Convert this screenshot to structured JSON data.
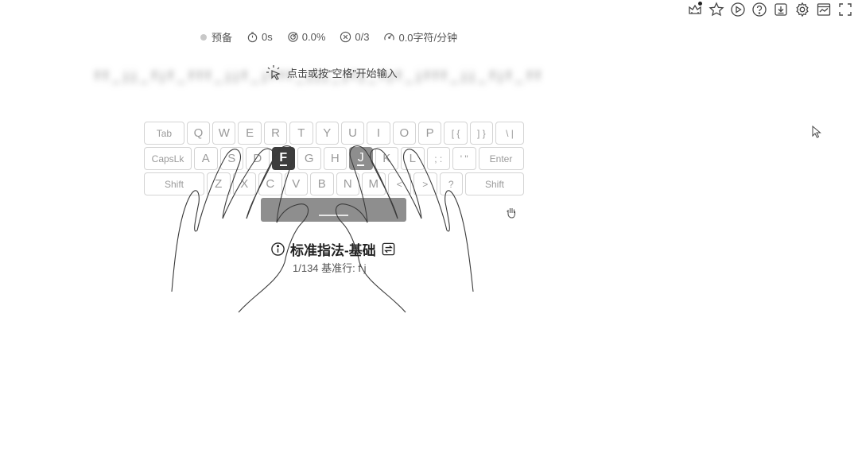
{
  "toolbar": {
    "items": [
      "crown-icon",
      "star-icon",
      "play-icon",
      "help-icon",
      "download-icon",
      "settings-icon",
      "chart-icon",
      "fullscreen-icon"
    ]
  },
  "stats": {
    "status": "预备",
    "time": "0s",
    "accuracy": "0.0%",
    "errors": "0/3",
    "speed": "0.0字符/分钟"
  },
  "prompt": {
    "text": "点击或按“空格”开始输入"
  },
  "keyboard": {
    "row1": [
      "Tab",
      "Q",
      "W",
      "E",
      "R",
      "T",
      "Y",
      "U",
      "I",
      "O",
      "P",
      "[ {",
      "] }",
      "\\ |"
    ],
    "row2": [
      "CapsLk",
      "A",
      "S",
      "D",
      "F",
      "G",
      "H",
      "J",
      "K",
      "L",
      ";  :",
      "' \"",
      "Enter"
    ],
    "row3": [
      "Shift",
      "Z",
      "X",
      "C",
      "V",
      "B",
      "N",
      "M",
      "<",
      ">",
      "?",
      "Shift"
    ],
    "highlight_dark": "F",
    "highlight_mid": "J"
  },
  "lesson": {
    "title": "标准指法-基础",
    "progress": "1/134",
    "subtitle": "基准行:  f j"
  },
  "colors": {
    "key_dark": "#3d3d3d",
    "key_mid": "#8e8e8e",
    "border": "#d4d4d4"
  }
}
